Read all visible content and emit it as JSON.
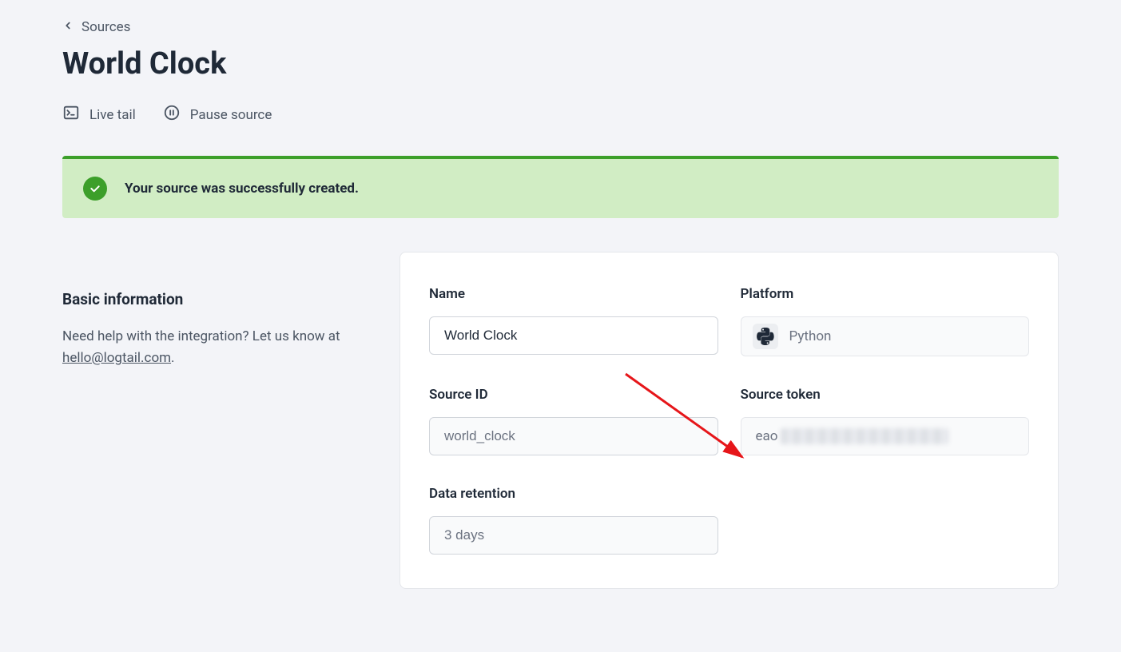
{
  "breadcrumb": {
    "label": "Sources"
  },
  "page": {
    "title": "World Clock"
  },
  "toolbar": {
    "live_tail_label": "Live tail",
    "pause_source_label": "Pause source"
  },
  "alert": {
    "message": "Your source was successfully created."
  },
  "side": {
    "heading": "Basic information",
    "help_prefix": "Need help with the integration? Let us know at ",
    "help_email": "hello@logtail.com",
    "help_suffix": "."
  },
  "form": {
    "name": {
      "label": "Name",
      "value": "World Clock"
    },
    "platform": {
      "label": "Platform",
      "value": "Python"
    },
    "source_id": {
      "label": "Source ID",
      "value": "world_clock"
    },
    "source_token": {
      "label": "Source token",
      "prefix": "eao"
    },
    "data_retention": {
      "label": "Data retention",
      "value": "3 days"
    }
  }
}
